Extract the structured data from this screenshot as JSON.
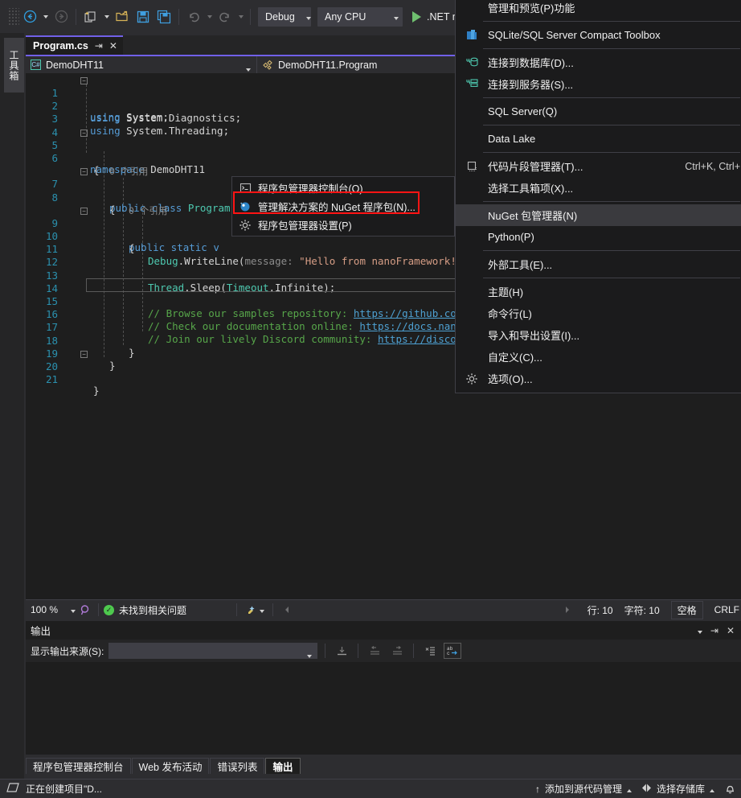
{
  "toolbar": {
    "back_icon": "back-arrow-icon",
    "forward_icon": "forward-arrow-icon",
    "new_item_icon": "new-item-icon",
    "open_icon": "open-folder-icon",
    "save_icon": "save-icon",
    "save_all_icon": "save-all-icon",
    "undo_icon": "undo-icon",
    "redo_icon": "redo-icon",
    "configuration": "Debug",
    "platform": "Any CPU",
    "run_label": ".NET nanoFram",
    "run_icon": "play-icon"
  },
  "left_dock": {
    "toolbox_tab": "工具箱"
  },
  "editor": {
    "tab_title": "Program.cs",
    "pin_icon": "pin-icon",
    "close_icon": "close-icon",
    "nav_project": "DemoDHT11",
    "nav_project_icon": "csharp-file-icon",
    "nav_member": "DemoDHT11.Program",
    "nav_member_icon": "namespace-icon",
    "lines": [
      {
        "n": "1",
        "text": "using System;"
      },
      {
        "n": "2",
        "text": "using System.Diagnostics;"
      },
      {
        "n": "3",
        "text": "using System.Threading;"
      },
      {
        "n": "4",
        "text": ""
      },
      {
        "n": "5",
        "text": "namespace DemoDHT11"
      },
      {
        "n": "6",
        "text": "{"
      },
      {
        "n": "",
        "text": "0 个引用"
      },
      {
        "n": "7",
        "text": "public class Program"
      },
      {
        "n": "8",
        "text": "{"
      },
      {
        "n": "",
        "text": "0 个引用"
      },
      {
        "n": "9",
        "text": "public static v"
      },
      {
        "n": "10",
        "text": "{"
      },
      {
        "n": "11",
        "text": "Debug.WriteLine(message: \"Hello from nanoFramework!\");"
      },
      {
        "n": "12",
        "text": ""
      },
      {
        "n": "13",
        "text": "Thread.Sleep(Timeout.Infinite);"
      },
      {
        "n": "14",
        "text": ""
      },
      {
        "n": "15",
        "text": "// Browse our samples repository: https://github.co"
      },
      {
        "n": "16",
        "text": "// Check our documentation online: https://docs.nan"
      },
      {
        "n": "17",
        "text": "// Join our lively Discord community: https://disco"
      },
      {
        "n": "18",
        "text": "}"
      },
      {
        "n": "19",
        "text": "}"
      },
      {
        "n": "20",
        "text": "}"
      },
      {
        "n": "21",
        "text": ""
      }
    ],
    "code": {
      "l1_kw": "using",
      "l1_rest": " System;",
      "l2_kw": "using",
      "l2_rest": " System.Diagnostics;",
      "l3_kw": "using",
      "l3_rest": " System.Threading;",
      "l5_kw": "namespace",
      "l5_rest": " DemoDHT11",
      "l6": "{",
      "ref0_a": "0 个引用",
      "l7_kw": "public class ",
      "l7_type": "Program",
      "l8": "{",
      "ref0_b": "0 个引用",
      "l9": "public static v",
      "l10": "{",
      "l11_a": "Debug",
      "l11_b": ".WriteLine(",
      "l11_c": "message:",
      "l11_d": " \"Hello from nanoFramework!\");",
      "l13_a": "Thread",
      "l13_b": ".Sleep(",
      "l13_c": "Timeout",
      "l13_d": ".Infinite);",
      "l15_c": "// Browse our samples repository: ",
      "l15_u": "https://github.co",
      "l16_c": "// Check our documentation online: ",
      "l16_u": "https://docs.nan",
      "l17_c": "// Join our lively Discord community: ",
      "l17_u": "https://disco",
      "l18": "}",
      "l19": "}",
      "l20": "}"
    },
    "status": {
      "zoom": "100 %",
      "zoom_caret_icon": "chevron-down-icon",
      "intellicode_icon": "intellicode-icon",
      "issues_icon": "check-circle-icon",
      "issues_text": "未找到相关问题",
      "broom_icon": "code-cleanup-icon",
      "broom_caret_icon": "chevron-down-icon",
      "collapse_icon": "collapse-left-icon",
      "expand_icon": "expand-right-icon",
      "line_label": "行: 10",
      "char_label": "字符: 10",
      "spaces_label": "空格",
      "eol_label": "CRLF"
    }
  },
  "output_pane": {
    "title": "输出",
    "caret_icon": "chevron-down-icon",
    "pin_icon": "pin-icon",
    "close_icon": "close-icon",
    "source_label": "显示输出来源(S):",
    "source_value": "",
    "source_caret_icon": "chevron-down-icon",
    "tool_icons": [
      "go-to-message-icon",
      "previous-message-icon",
      "next-message-icon",
      "clear-all-icon",
      "word-wrap-icon"
    ]
  },
  "pane_tabs": [
    {
      "label": "程序包管理器控制台",
      "active": false
    },
    {
      "label": "Web 发布活动",
      "active": false
    },
    {
      "label": "错误列表",
      "active": false
    },
    {
      "label": "输出",
      "active": true
    }
  ],
  "status_bar": {
    "ready_icon": "ready-icon",
    "ready_text": "正在创建项目\"D...",
    "source_control_icon": "up-arrow-icon",
    "source_control_text": "添加到源代码管理",
    "source_control_caret_icon": "chevron-up-icon",
    "repo_icon": "repository-icon",
    "repo_text": "选择存储库",
    "repo_caret_icon": "chevron-up-icon",
    "bell_icon": "notification-bell-icon"
  },
  "tools_menu": {
    "items": [
      {
        "label": "管理和预览(P)功能",
        "icon": "",
        "shortcut": "",
        "sep_after": true,
        "highlight": false
      },
      {
        "label": "SQLite/SQL Server Compact Toolbox",
        "icon": "sqlite-toolbox-icon",
        "shortcut": "",
        "sep_after": true,
        "highlight": false
      },
      {
        "label": "连接到数据库(D)...",
        "icon": "connect-database-icon",
        "shortcut": "",
        "sep_after": false,
        "highlight": false
      },
      {
        "label": "连接到服务器(S)...",
        "icon": "connect-server-icon",
        "shortcut": "",
        "sep_after": true,
        "highlight": false
      },
      {
        "label": "SQL Server(Q)",
        "icon": "",
        "shortcut": "",
        "sep_after": true,
        "highlight": false
      },
      {
        "label": "Data Lake",
        "icon": "",
        "shortcut": "",
        "sep_after": true,
        "highlight": false
      },
      {
        "label": "代码片段管理器(T)...",
        "icon": "code-snippet-icon",
        "shortcut": "Ctrl+K, Ctrl+",
        "sep_after": false,
        "highlight": false
      },
      {
        "label": "选择工具箱项(X)...",
        "icon": "",
        "shortcut": "",
        "sep_after": true,
        "highlight": false
      },
      {
        "label": "NuGet 包管理器(N)",
        "icon": "",
        "shortcut": "",
        "sep_after": false,
        "highlight": true
      },
      {
        "label": "Python(P)",
        "icon": "",
        "shortcut": "",
        "sep_after": true,
        "highlight": false
      },
      {
        "label": "外部工具(E)...",
        "icon": "",
        "shortcut": "",
        "sep_after": true,
        "highlight": false
      },
      {
        "label": "主题(H)",
        "icon": "",
        "shortcut": "",
        "sep_after": false,
        "highlight": false
      },
      {
        "label": "命令行(L)",
        "icon": "",
        "shortcut": "",
        "sep_after": false,
        "highlight": false
      },
      {
        "label": "导入和导出设置(I)...",
        "icon": "",
        "shortcut": "",
        "sep_after": false,
        "highlight": false
      },
      {
        "label": "自定义(C)...",
        "icon": "",
        "shortcut": "",
        "sep_after": false,
        "highlight": false
      },
      {
        "label": "选项(O)...",
        "icon": "gear-icon",
        "shortcut": "",
        "sep_after": false,
        "highlight": false
      }
    ]
  },
  "nuget_submenu": {
    "items": [
      {
        "label": "程序包管理器控制台(O)",
        "icon": "console-icon",
        "boxed": false
      },
      {
        "label": "管理解决方案的 NuGet 程序包(N)...",
        "icon": "nuget-icon",
        "boxed": true
      },
      {
        "label": "程序包管理器设置(P)",
        "icon": "gear-icon",
        "boxed": false
      }
    ],
    "highlight_color": "#ff1414"
  }
}
